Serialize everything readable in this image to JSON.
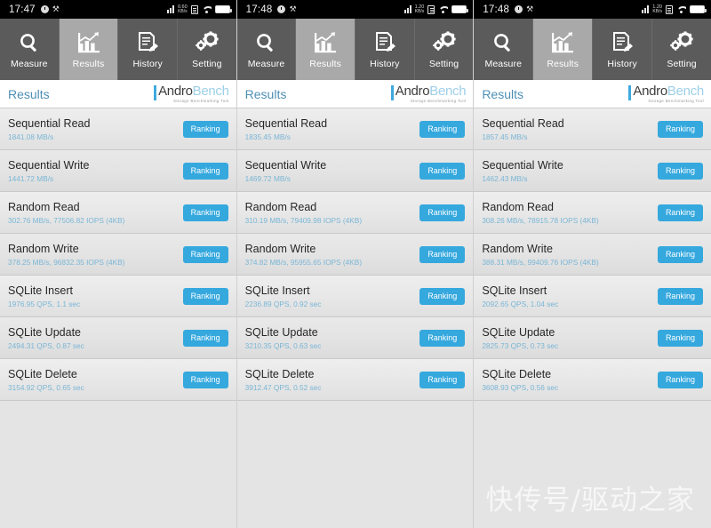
{
  "watermark": "快传号/驱动之家",
  "tabs": [
    {
      "label": "Measure",
      "icon": "magnifier-icon",
      "active": false
    },
    {
      "label": "Results",
      "icon": "bar-chart-icon",
      "active": true
    },
    {
      "label": "History",
      "icon": "document-pencil-icon",
      "active": false
    },
    {
      "label": "Setting",
      "icon": "gears-icon",
      "active": false
    }
  ],
  "header": {
    "title": "Results",
    "logo_andro": "Andro",
    "logo_bench": "Bench",
    "logo_subtitle": "Storage Benchmarking Tool"
  },
  "ranking_label": "Ranking",
  "colors": {
    "accent_blue": "#35a8de",
    "value_blue": "#7ab6d6",
    "title_blue": "#4e8fb5",
    "tab_bg": "#5b5b5b",
    "tab_active_bg": "#a9a9a9",
    "row_bg": "#e9e9e9"
  },
  "status_icons": [
    "alarm-icon",
    "tools-icon",
    "signal-icon",
    "data-rate-icon",
    "sim-card-icon",
    "wifi-icon",
    "battery-icon"
  ],
  "panels": [
    {
      "status": {
        "time": "17:47",
        "rate_value": "0.60",
        "rate_unit": "KB/s"
      },
      "rows": [
        {
          "title": "Sequential Read",
          "value": "1841.08 MB/s"
        },
        {
          "title": "Sequential Write",
          "value": "1441.72 MB/s"
        },
        {
          "title": "Random Read",
          "value": "302.76 MB/s, 77506.82 IOPS (4KB)"
        },
        {
          "title": "Random Write",
          "value": "378.25 MB/s, 96832.35 IOPS (4KB)"
        },
        {
          "title": "SQLite Insert",
          "value": "1976.95 QPS, 1.1 sec"
        },
        {
          "title": "SQLite Update",
          "value": "2494.31 QPS, 0.87 sec"
        },
        {
          "title": "SQLite Delete",
          "value": "3154.92 QPS, 0.65 sec"
        }
      ]
    },
    {
      "status": {
        "time": "17:48",
        "rate_value": "1.20",
        "rate_unit": "KB/s"
      },
      "rows": [
        {
          "title": "Sequential Read",
          "value": "1835.45 MB/s"
        },
        {
          "title": "Sequential Write",
          "value": "1469.72 MB/s"
        },
        {
          "title": "Random Read",
          "value": "310.19 MB/s, 79409.98 IOPS (4KB)"
        },
        {
          "title": "Random Write",
          "value": "374.82 MB/s, 95955.65 IOPS (4KB)"
        },
        {
          "title": "SQLite Insert",
          "value": "2236.89 QPS, 0.92 sec"
        },
        {
          "title": "SQLite Update",
          "value": "3210.35 QPS, 0.63 sec"
        },
        {
          "title": "SQLite Delete",
          "value": "3912.47 QPS, 0.52 sec"
        }
      ]
    },
    {
      "status": {
        "time": "17:48",
        "rate_value": "1.20",
        "rate_unit": "KB/s"
      },
      "rows": [
        {
          "title": "Sequential Read",
          "value": "1857.45 MB/s"
        },
        {
          "title": "Sequential Write",
          "value": "1462.43 MB/s"
        },
        {
          "title": "Random Read",
          "value": "308.26 MB/s, 78915.78 IOPS (4KB)"
        },
        {
          "title": "Random Write",
          "value": "388.31 MB/s, 99409.76 IOPS (4KB)"
        },
        {
          "title": "SQLite Insert",
          "value": "2092.65 QPS, 1.04 sec"
        },
        {
          "title": "SQLite Update",
          "value": "2825.73 QPS, 0.73 sec"
        },
        {
          "title": "SQLite Delete",
          "value": "3608.93 QPS, 0.56 sec"
        }
      ]
    }
  ]
}
